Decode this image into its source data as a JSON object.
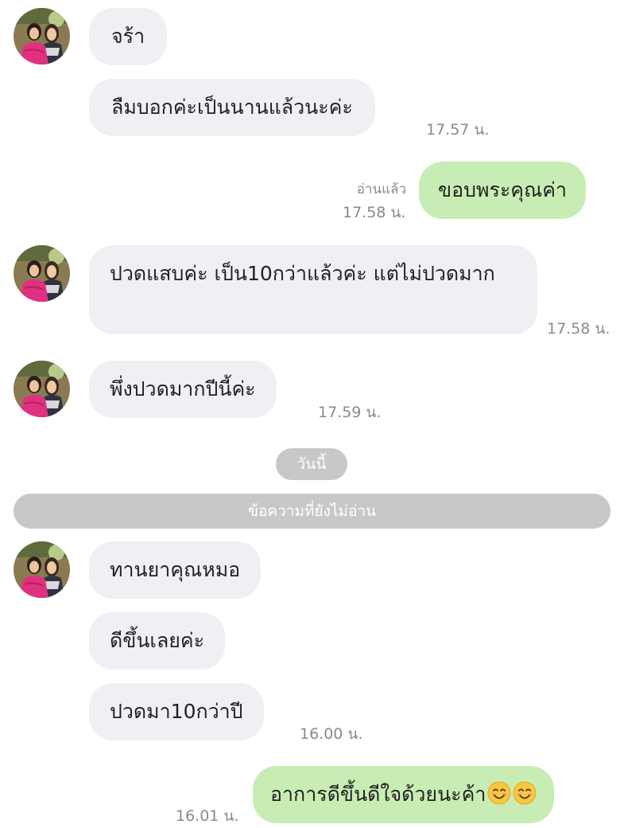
{
  "contact": {
    "avatar_icon": "contact-avatar-photo"
  },
  "messages": [
    {
      "text": "จร้า",
      "time": ""
    },
    {
      "text": "ลืมบอกค่ะเป็นนานแล้วนะค่ะ",
      "time": "17.57 น."
    },
    {
      "text": "ขอบพระคุณค่า",
      "time": "17.58 น.",
      "status": "อ่านแล้ว"
    },
    {
      "text": "ปวดแสบค่ะ เป็น10กว่าแล้วค่ะ แต่ไม่ปวดมาก",
      "time": "17.58 น."
    },
    {
      "text": "พึ่งปวดมากปีนี้ค่ะ",
      "time": "17.59 น."
    },
    {
      "text": "ทานยาคุณหมอ",
      "time": ""
    },
    {
      "text": "ดีขึ้นเลยค่ะ",
      "time": ""
    },
    {
      "text": "ปวดมา10กว่าปี",
      "time": "16.00 น."
    },
    {
      "text": "อาการดีขึ้นดีใจด้วยนะค้า",
      "time": "16.01 น.",
      "emoji": "smiling-face-emoji"
    }
  ],
  "date_separator": "วันนี้",
  "unread_divider": "ข้อความที่ยังไม่อ่าน",
  "colors": {
    "incoming_bubble": "#eef0f3",
    "outgoing_bubble": "#c8edb4",
    "timestamp": "#8a8a8a",
    "separator": "#c8c8c8"
  }
}
